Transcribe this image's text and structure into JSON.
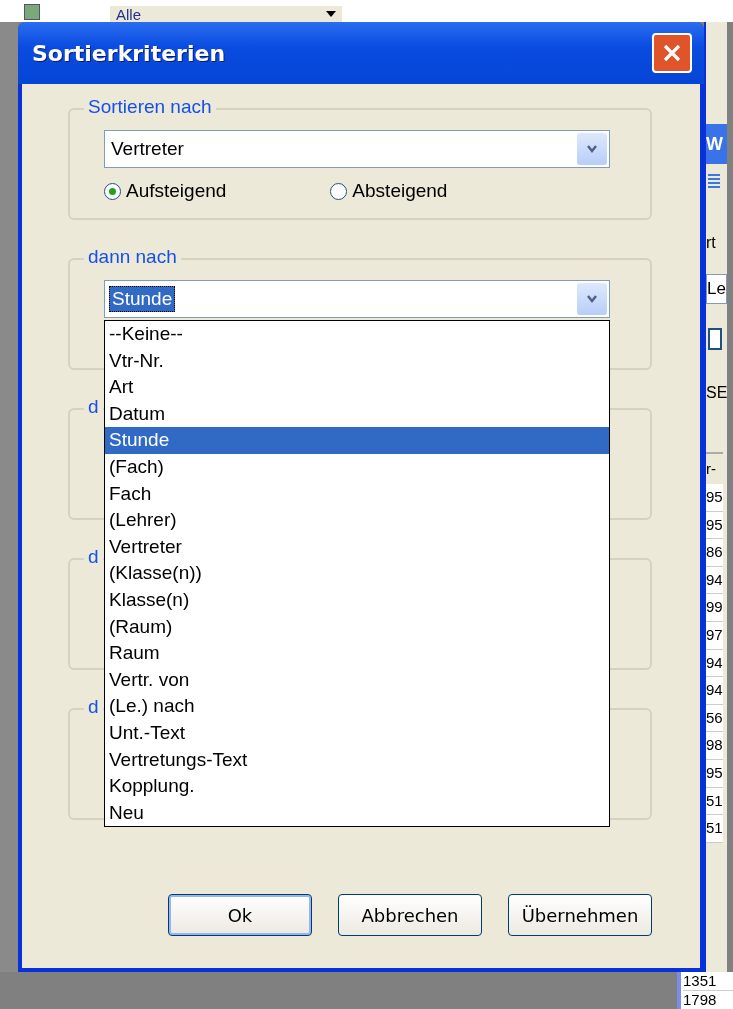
{
  "background": {
    "toolbar_filter": "Alle",
    "side_panel": {
      "title": "W",
      "texts": [
        "rt",
        "Le",
        "SE"
      ],
      "checkbox_checked": false,
      "column_heading": "r-",
      "cells": [
        "95",
        "95",
        "86",
        "94",
        "99",
        "97",
        "94",
        "94",
        "56",
        "98",
        "95",
        "51",
        "51"
      ]
    },
    "bottom_cells": [
      "1351",
      "1798"
    ]
  },
  "dialog": {
    "title": "Sortierkriterien",
    "groups": [
      {
        "kind": "primary",
        "label": "Sortieren nach",
        "value": "Vertreter",
        "order_options": [
          {
            "label": "Aufsteigend",
            "selected": true
          },
          {
            "label": "Absteigend",
            "selected": false
          }
        ]
      },
      {
        "kind": "open",
        "label": "dann nach",
        "value": "Stunde",
        "options": [
          {
            "label": "--Keine--",
            "selected": false
          },
          {
            "label": "Vtr-Nr.",
            "selected": false
          },
          {
            "label": "Art",
            "selected": false
          },
          {
            "label": "Datum",
            "selected": false
          },
          {
            "label": "Stunde",
            "selected": true
          },
          {
            "label": "(Fach)",
            "selected": false
          },
          {
            "label": "Fach",
            "selected": false
          },
          {
            "label": "(Lehrer)",
            "selected": false
          },
          {
            "label": "Vertreter",
            "selected": false
          },
          {
            "label": "(Klasse(n))",
            "selected": false
          },
          {
            "label": "Klasse(n)",
            "selected": false
          },
          {
            "label": "(Raum)",
            "selected": false
          },
          {
            "label": "Raum",
            "selected": false
          },
          {
            "label": "Vertr. von",
            "selected": false
          },
          {
            "label": "(Le.) nach",
            "selected": false
          },
          {
            "label": "Unt.-Text",
            "selected": false
          },
          {
            "label": "Vertretungs-Text",
            "selected": false
          },
          {
            "label": "Kopplung.",
            "selected": false
          },
          {
            "label": "Neu",
            "selected": false
          }
        ]
      },
      {
        "kind": "covered",
        "label": "d"
      },
      {
        "kind": "covered",
        "label": "d"
      },
      {
        "kind": "covered",
        "label": "d"
      }
    ],
    "buttons": [
      {
        "label": "Ok",
        "default": true
      },
      {
        "label": "Abbrechen",
        "default": false
      },
      {
        "label": "Übernehmen",
        "default": false
      }
    ]
  }
}
